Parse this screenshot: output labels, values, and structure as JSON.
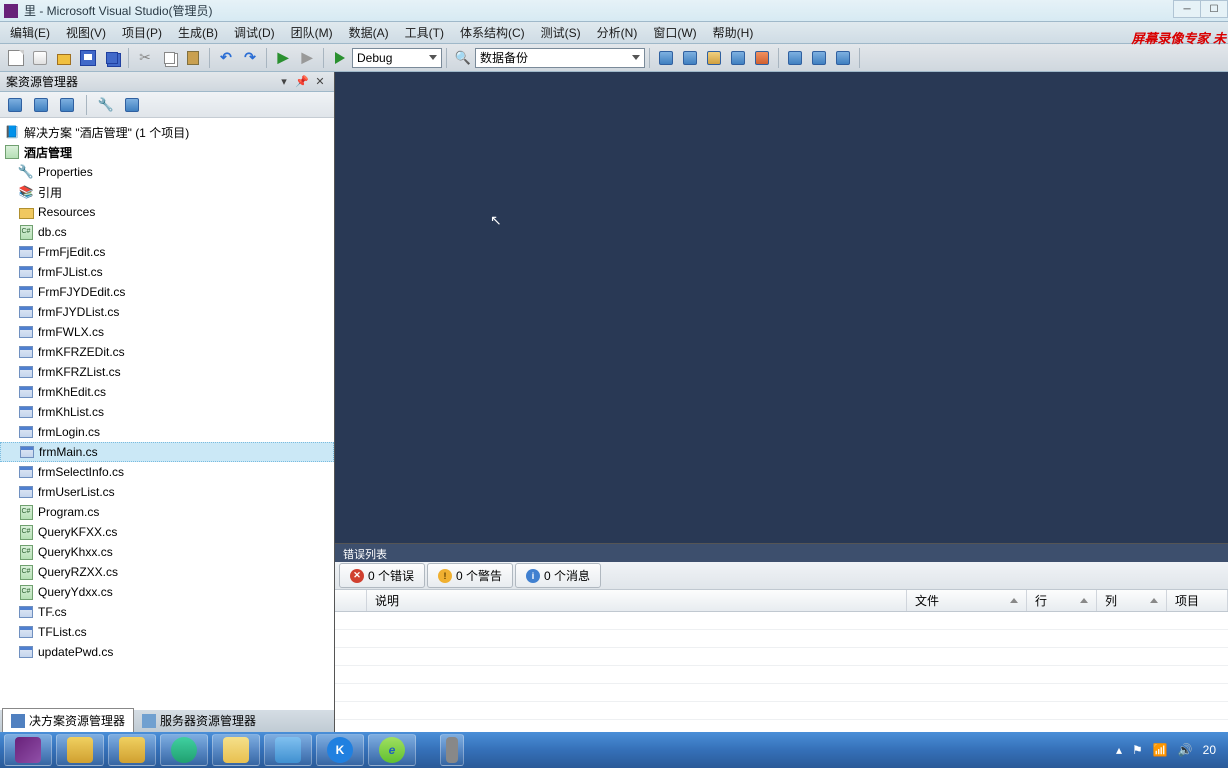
{
  "titlebar": {
    "text": "里 - Microsoft Visual Studio(管理员)"
  },
  "watermark": "屏幕录像专家 未",
  "menu": {
    "items": [
      "编辑(E)",
      "视图(V)",
      "项目(P)",
      "生成(B)",
      "调试(D)",
      "团队(M)",
      "数据(A)",
      "工具(T)",
      "体系结构(C)",
      "测试(S)",
      "分析(N)",
      "窗口(W)",
      "帮助(H)"
    ]
  },
  "toolbar": {
    "config": "Debug",
    "combo2": "数据备份"
  },
  "solution_explorer": {
    "title": "案资源管理器",
    "root": "解决方案 \"酒店管理\" (1 个项目)",
    "project": "酒店管理",
    "nodes": [
      {
        "type": "props",
        "label": "Properties"
      },
      {
        "type": "ref",
        "label": "引用"
      },
      {
        "type": "folder",
        "label": "Resources"
      },
      {
        "type": "cs",
        "label": "db.cs"
      },
      {
        "type": "form",
        "label": "FrmFjEdit.cs"
      },
      {
        "type": "form",
        "label": "frmFJList.cs"
      },
      {
        "type": "form",
        "label": "FrmFJYDEdit.cs"
      },
      {
        "type": "form",
        "label": "frmFJYDList.cs"
      },
      {
        "type": "form",
        "label": "frmFWLX.cs"
      },
      {
        "type": "form",
        "label": "frmKFRZEDit.cs"
      },
      {
        "type": "form",
        "label": "frmKFRZList.cs"
      },
      {
        "type": "form",
        "label": "frmKhEdit.cs"
      },
      {
        "type": "form",
        "label": "frmKhList.cs"
      },
      {
        "type": "form",
        "label": "frmLogin.cs"
      },
      {
        "type": "form",
        "label": "frmMain.cs",
        "selected": true
      },
      {
        "type": "form",
        "label": "frmSelectInfo.cs"
      },
      {
        "type": "form",
        "label": "frmUserList.cs"
      },
      {
        "type": "cs",
        "label": "Program.cs"
      },
      {
        "type": "cs",
        "label": "QueryKFXX.cs"
      },
      {
        "type": "cs",
        "label": "QueryKhxx.cs"
      },
      {
        "type": "cs",
        "label": "QueryRZXX.cs"
      },
      {
        "type": "cs",
        "label": "QueryYdxx.cs"
      },
      {
        "type": "form",
        "label": "TF.cs"
      },
      {
        "type": "form",
        "label": "TFList.cs"
      },
      {
        "type": "form",
        "label": "updatePwd.cs"
      }
    ],
    "tabs": {
      "active": "决方案资源管理器",
      "other": "服务器资源管理器"
    }
  },
  "error_list": {
    "title": "错误列表",
    "tabs": {
      "errors": "0 个错误",
      "warnings": "0 个警告",
      "messages": "0 个消息"
    },
    "columns": [
      "说明",
      "文件",
      "行",
      "列",
      "项目"
    ]
  },
  "tray": {
    "time": "20"
  }
}
